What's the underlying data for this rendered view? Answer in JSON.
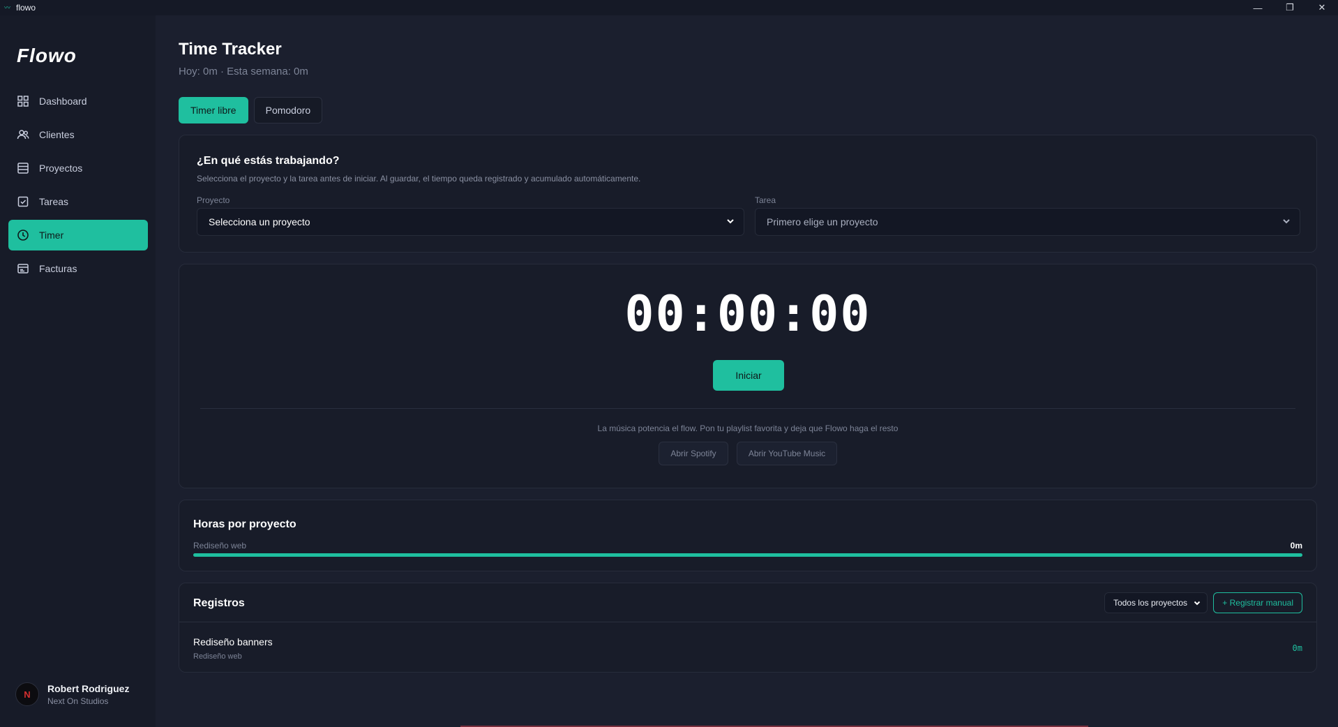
{
  "window": {
    "title": "flowo",
    "minimize": "—",
    "maximize": "❐",
    "close": "✕"
  },
  "sidebar": {
    "logo": "Flowo",
    "items": [
      {
        "label": "Dashboard",
        "icon": "grid-icon"
      },
      {
        "label": "Clientes",
        "icon": "users-icon"
      },
      {
        "label": "Proyectos",
        "icon": "list-icon"
      },
      {
        "label": "Tareas",
        "icon": "checkbox-icon"
      },
      {
        "label": "Timer",
        "icon": "clock-icon",
        "active": true
      },
      {
        "label": "Facturas",
        "icon": "invoice-icon"
      }
    ],
    "user": {
      "initials": "N",
      "name": "Robert Rodriguez",
      "company": "Next On Studios"
    }
  },
  "header": {
    "title": "Time Tracker",
    "subtitle": "Hoy: 0m · Esta semana: 0m"
  },
  "tabs": [
    {
      "label": "Timer libre",
      "active": true
    },
    {
      "label": "Pomodoro",
      "active": false
    }
  ],
  "task_card": {
    "title": "¿En qué estás trabajando?",
    "description": "Selecciona el proyecto y la tarea antes de iniciar. Al guardar, el tiempo queda registrado y acumulado automáticamente.",
    "project_label": "Proyecto",
    "project_value": "Selecciona un proyecto",
    "task_label": "Tarea",
    "task_value": "Primero elige un proyecto"
  },
  "timer": {
    "display": "00:00:00",
    "start_label": "Iniciar",
    "music_text": "La música potencia el flow. Pon tu playlist favorita y deja que Flowo haga el resto",
    "spotify_label": "Abrir Spotify",
    "youtube_label": "Abrir YouTube Music"
  },
  "hours_by_project": {
    "title": "Horas por proyecto",
    "rows": [
      {
        "project": "Rediseño web",
        "value": "0m",
        "fraction": 1.0
      }
    ]
  },
  "records": {
    "title": "Registros",
    "filter_value": "Todos los proyectos",
    "manual_label": "+ Registrar manual",
    "items": [
      {
        "task": "Rediseño banners",
        "project": "Rediseño web",
        "time": "0m"
      }
    ]
  },
  "colors": {
    "accent": "#1fbf9f",
    "background": "#1b1f2e",
    "sidebar": "#171b28"
  }
}
